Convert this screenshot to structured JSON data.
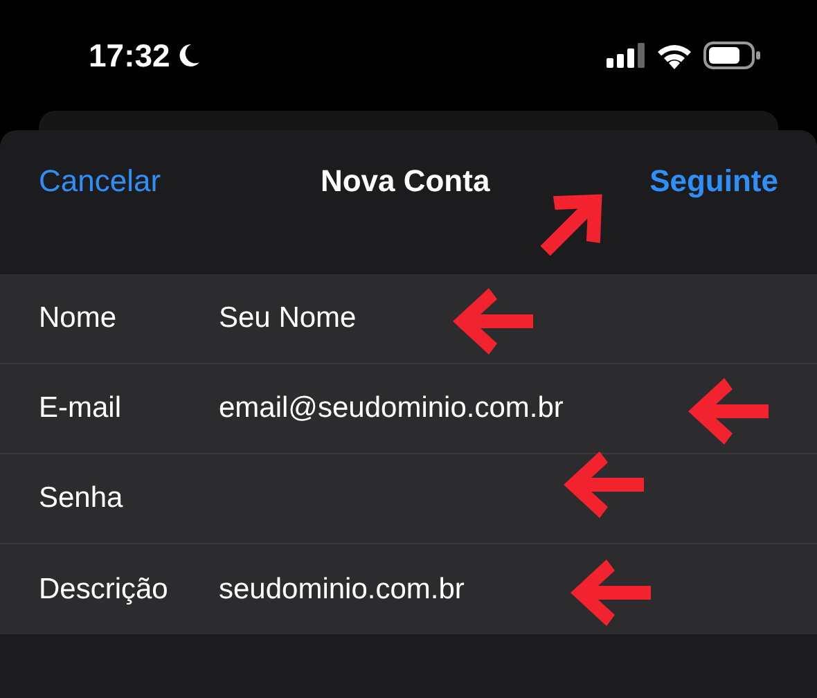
{
  "status_bar": {
    "time": "17:32"
  },
  "nav": {
    "cancel": "Cancelar",
    "title": "Nova Conta",
    "next": "Seguinte"
  },
  "fields": [
    {
      "label": "Nome",
      "value": "Seu Nome"
    },
    {
      "label": "E-mail",
      "value": "email@seudominio.com.br"
    },
    {
      "label": "Senha"
    },
    {
      "label": "Descrição",
      "value": "seudominio.com.br"
    }
  ]
}
